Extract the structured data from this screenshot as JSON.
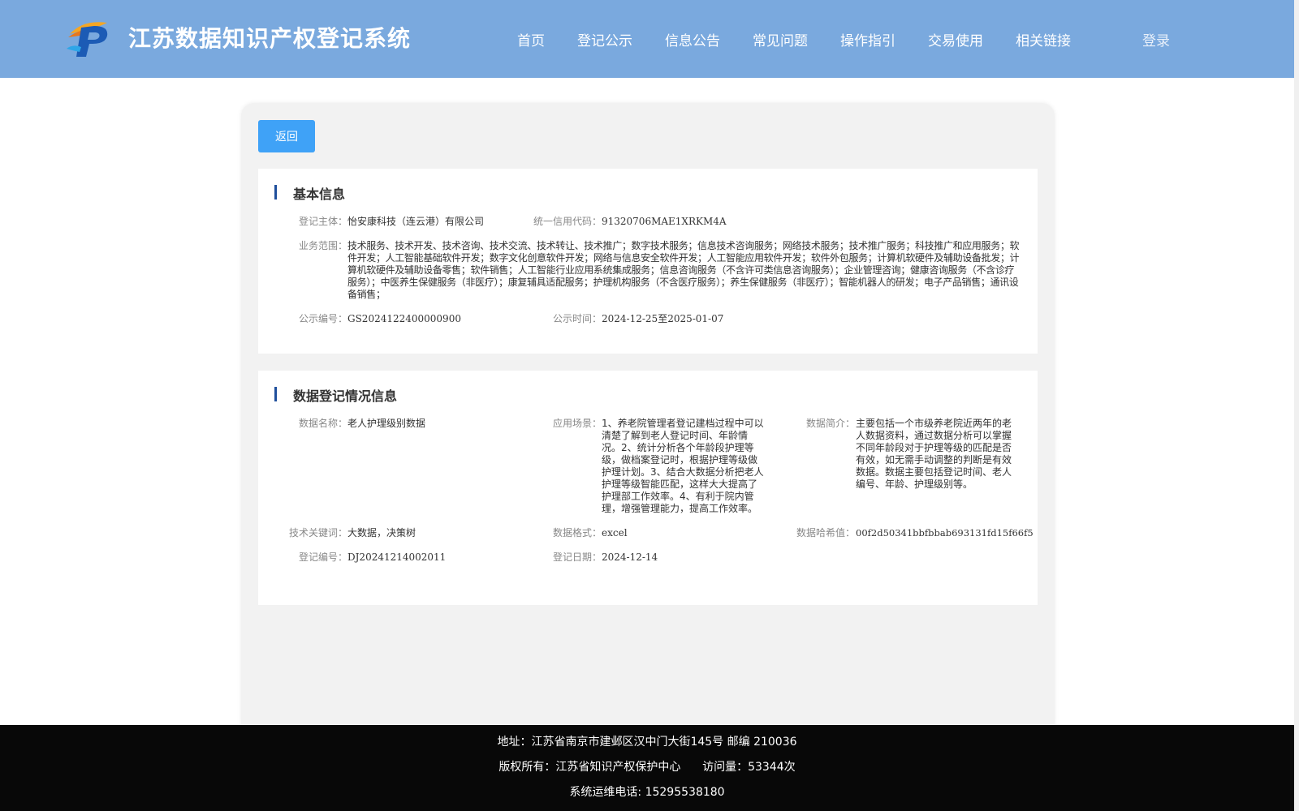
{
  "header": {
    "title": "江苏数据知识产权登记系统",
    "nav": [
      "首页",
      "登记公示",
      "信息公告",
      "常见问题",
      "操作指引",
      "交易使用",
      "相关链接"
    ],
    "login": "登录"
  },
  "back_button": "返回",
  "basic_info": {
    "section_title": "基本信息",
    "subject_label": "登记主体：",
    "subject_value": "怡安康科技（连云港）有限公司",
    "credit_code_label": "统一信用代码：",
    "credit_code_value": "91320706MAE1XRKM4A",
    "business_scope_label": "业务范围：",
    "business_scope_value": "技术服务、技术开发、技术咨询、技术交流、技术转让、技术推广；数字技术服务；信息技术咨询服务；网络技术服务；技术推广服务；科技推广和应用服务；软件开发；人工智能基础软件开发；数字文化创意软件开发；网络与信息安全软件开发；人工智能应用软件开发；软件外包服务；计算机软硬件及辅助设备批发；计算机软硬件及辅助设备零售；软件销售；人工智能行业应用系统集成服务；信息咨询服务（不含许可类信息咨询服务）；企业管理咨询；健康咨询服务（不含诊疗服务）；中医养生保健服务（非医疗）；康复辅具适配服务；护理机构服务（不含医疗服务）；养生保健服务（非医疗）；智能机器人的研发；电子产品销售；通讯设备销售；",
    "notice_no_label": "公示编号：",
    "notice_no_value": "GS2024122400000900",
    "notice_time_label": "公示时间：",
    "notice_time_value": "2024-12-25至2025-01-07"
  },
  "data_info": {
    "section_title": "数据登记情况信息",
    "name_label": "数据名称：",
    "name_value": "老人护理级别数据",
    "scene_label": "应用场景：",
    "scene_value": "1、养老院管理者登记建档过程中可以清楚了解到老人登记时间、年龄情况。2、统计分析各个年龄段护理等级，做档案登记时，根据护理等级做护理计划。3、结合大数据分析把老人护理等级智能匹配，这样大大提高了护理部工作效率。4、有利于院内管理，增强管理能力，提高工作效率。",
    "intro_label": "数据简介：",
    "intro_value": "主要包括一个市级养老院近两年的老人数据资料，通过数据分析可以掌握不同年龄段对于护理等级的匹配是否有效，如无需手动调整的判断是有效数据。数据主要包括登记时间、老人编号、年龄、护理级别等。",
    "keywords_label": "技术关键词：",
    "keywords_value": "大数据，决策树",
    "format_label": "数据格式：",
    "format_value": "excel",
    "hash_label": "数据哈希值：",
    "hash_value": "00f2d50341bbfbbab693131fd15f66f5",
    "reg_no_label": "登记编号：",
    "reg_no_value": "DJ20241214002011",
    "reg_date_label": "登记日期：",
    "reg_date_value": "2024-12-14"
  },
  "footer": {
    "address": "地址：江苏省南京市建邺区汉中门大街145号 邮编 210036",
    "copyright": "版权所有：江苏省知识产权保护中心      访问量：53344次",
    "phone": "系统运维电话: 15295538180"
  }
}
